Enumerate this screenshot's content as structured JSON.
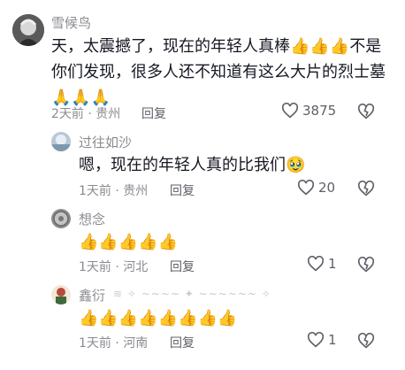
{
  "comments": [
    {
      "username": "雪候鸟",
      "text": "天，太震撼了，现在的年轻人真棒👍👍👍不是你们发现，很多人还不知道有这么大片的烈士墓🙏🙏🙏",
      "meta": "2天前 · 贵州",
      "reply": "回复",
      "likes": "3875"
    },
    {
      "username": "过往如沙",
      "text": "嗯，现在的年轻人真的比我们🥹",
      "meta": "1天前 · 贵州",
      "reply": "回复",
      "likes": "20"
    },
    {
      "username": "想念",
      "text": "👍👍👍👍👍",
      "meta": "1天前 · 河北",
      "reply": "回复",
      "likes": "1"
    },
    {
      "username": "鑫衍",
      "text": "👍👍👍👍👍👍👍👍",
      "meta": "1天前 · 河南",
      "reply": "回复",
      "likes": "1"
    }
  ],
  "icons": {
    "like": "heart-outline-icon",
    "dislike": "broken-heart-icon"
  },
  "colors": {
    "muted": "#8a8b91",
    "text": "#161823",
    "reply": "#5f6068"
  }
}
